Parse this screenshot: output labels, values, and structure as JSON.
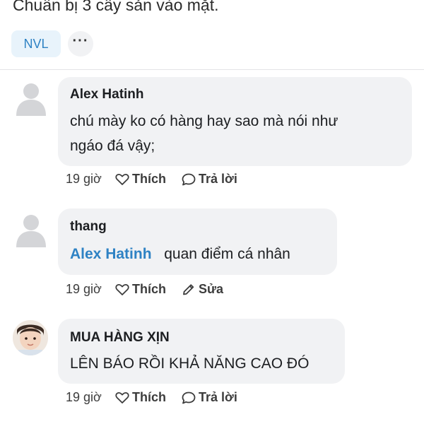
{
  "post": {
    "text": "Chuẩn bị 3 cây sản vào mặt.",
    "tag": "NVL",
    "more_label": "···"
  },
  "comments": [
    {
      "author": "Alex Hatinh",
      "lines": [
        "chú mày ko có hàng hay sao mà nói như",
        "ngáo đá vậy;"
      ],
      "time": "19 giờ",
      "like_label": "Thích",
      "action_label": "Trả lời",
      "action_icon": "reply-bubble-icon",
      "avatar": "default-avatar-icon"
    },
    {
      "author": "thang",
      "mention": "Alex Hatinh",
      "text": "quan điểm cá nhân",
      "time": "19 giờ",
      "like_label": "Thích",
      "action_label": "Sửa",
      "action_icon": "pencil-icon",
      "avatar": "default-avatar-icon"
    },
    {
      "author": "MUA HÀNG XỊN",
      "text": "LÊN BÁO RỒI KHẢ NĂNG CAO ĐÓ",
      "time": "19 giờ",
      "like_label": "Thích",
      "action_label": "Trả lời",
      "action_icon": "reply-bubble-icon",
      "avatar": "child-photo-avatar"
    }
  ],
  "colors": {
    "link": "#2e82c4",
    "bubble": "#f1f2f4",
    "tag_bg": "#e8f3fb"
  }
}
